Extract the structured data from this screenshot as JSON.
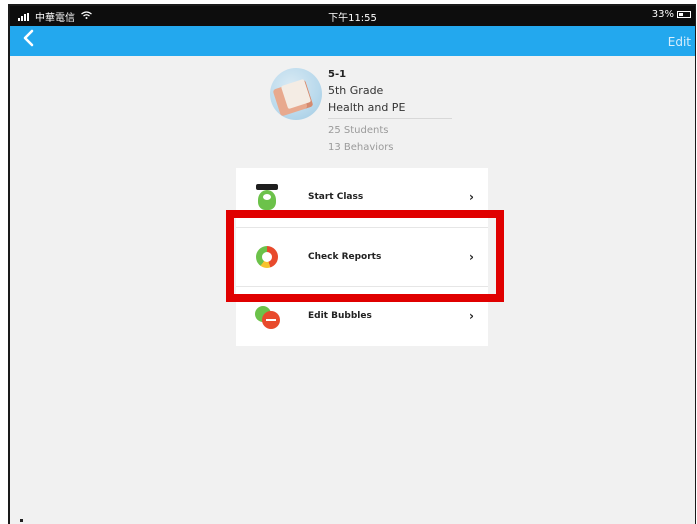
{
  "status_bar": {
    "carrier": "中華電信",
    "time": "下午11:55",
    "battery": "33%"
  },
  "nav": {
    "back_icon": "chevron-left-icon",
    "edit_label": "Edit"
  },
  "class_info": {
    "name": "5-1",
    "grade": "5th Grade",
    "subject": "Health and PE",
    "students": "25 Students",
    "behaviors": "13 Behaviors"
  },
  "menu": {
    "items": [
      {
        "label": "Start Class",
        "icon": "monster-icon"
      },
      {
        "label": "Check Reports",
        "icon": "report-ring-icon"
      },
      {
        "label": "Edit Bubbles",
        "icon": "bubbles-icon"
      }
    ],
    "chevron": "›"
  },
  "colors": {
    "nav_blue": "#23a8ee",
    "highlight_red": "#e00000",
    "background": "#f1f1f1"
  }
}
